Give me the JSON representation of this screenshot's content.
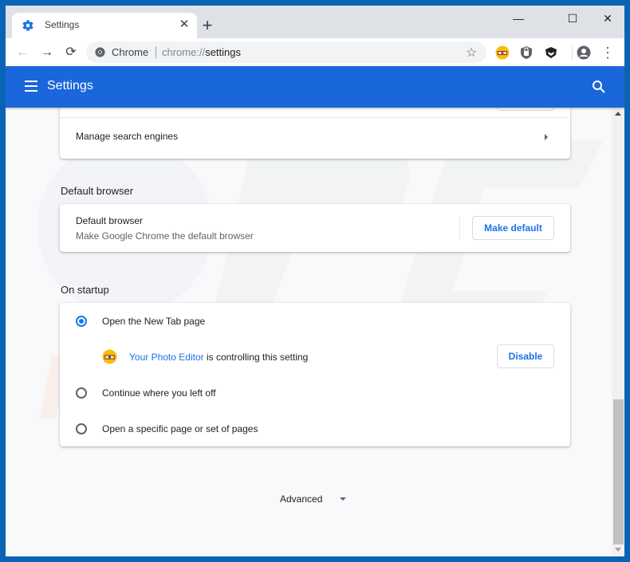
{
  "browser": {
    "tab": {
      "title": "Settings",
      "icon": "gear-icon"
    },
    "new_tab_label": "+",
    "window_controls": {
      "minimize": "—",
      "maximize": "☐",
      "close": "✕"
    },
    "nav": {
      "back": "←",
      "forward": "→",
      "reload": "⟳"
    },
    "omnibox": {
      "scheme_label": "Chrome",
      "url_prefix": "chrome://",
      "url_path": "settings"
    },
    "bookmark_star": "☆",
    "extensions": [
      "photo-editor-extension-icon",
      "shield-extension-icon",
      "helmet-extension-icon"
    ],
    "menu": "⋮"
  },
  "header": {
    "title": "Settings"
  },
  "search_engine_card": {
    "manage_label": "Manage search engines"
  },
  "default_browser": {
    "section_title": "Default browser",
    "row_title": "Default browser",
    "row_subtitle": "Make Google Chrome the default browser",
    "button_label": "Make default"
  },
  "on_startup": {
    "section_title": "On startup",
    "options": [
      {
        "label": "Open the New Tab page",
        "selected": true
      },
      {
        "label": "Continue where you left off",
        "selected": false
      },
      {
        "label": "Open a specific page or set of pages",
        "selected": false
      }
    ],
    "extension_notice": {
      "extension_name": "Your Photo Editor",
      "suffix": " is controlling this setting",
      "button_label": "Disable"
    }
  },
  "advanced": {
    "label": "Advanced"
  },
  "colors": {
    "accent": "#1a73e8",
    "header": "#1a66db",
    "window_frame": "#0a64b4"
  }
}
